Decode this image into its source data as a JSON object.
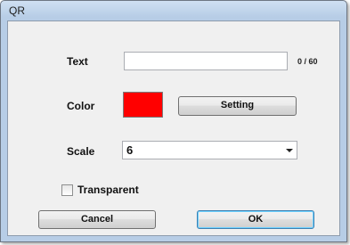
{
  "window": {
    "title": "QR"
  },
  "form": {
    "text_label": "Text",
    "text_value": "",
    "text_counter": "0 / 60",
    "color_label": "Color",
    "color_value": "#ff0000",
    "setting_button": "Setting",
    "scale_label": "Scale",
    "scale_value": "6",
    "transparent_label": "Transparent",
    "transparent_checked": false
  },
  "buttons": {
    "cancel": "Cancel",
    "ok": "OK"
  }
}
